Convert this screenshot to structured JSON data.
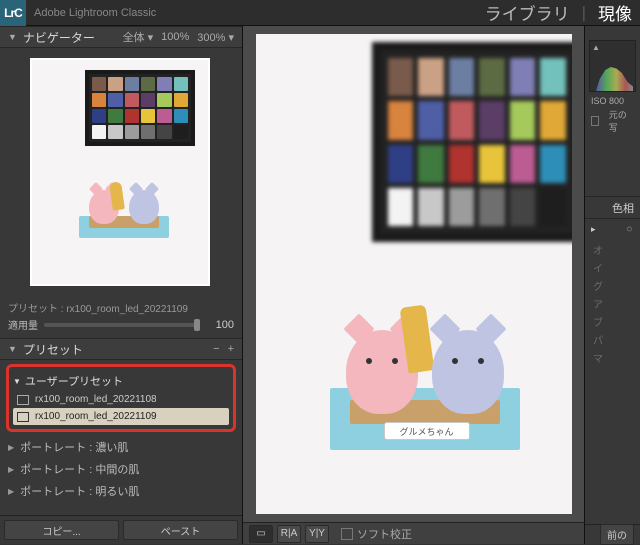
{
  "app": {
    "logo": "LrC",
    "name": "Adobe Lightroom Classic"
  },
  "modules": {
    "inactive": "ライブラリ",
    "sep": "|",
    "active": "現像"
  },
  "navigator": {
    "title": "ナビゲーター",
    "fit": "全体",
    "zoom1": "100%",
    "zoom2": "300%"
  },
  "preset_applied": {
    "label": "プリセット : rx100_room_led_20221109",
    "amount_label": "適用量",
    "amount_value": "100"
  },
  "presets_panel": {
    "title": "プリセット",
    "minus": "−",
    "plus": "+",
    "user_group": "ユーザープリセット",
    "items": [
      {
        "name": "rx100_room_led_20221108",
        "selected": false
      },
      {
        "name": "rx100_room_led_20221109",
        "selected": true
      }
    ],
    "builtins": [
      "ポートレート : 濃い肌",
      "ポートレート : 中間の肌",
      "ポートレート : 明るい肌"
    ],
    "copy": "コピー...",
    "paste": "ペースト"
  },
  "viewer": {
    "checker_colors": [
      "#7a5a4a",
      "#caa185",
      "#6c7fa3",
      "#5d6b44",
      "#7f7fb5",
      "#73c1bc",
      "#d8833e",
      "#4f5fa6",
      "#c15a5e",
      "#5a3e66",
      "#a6c95c",
      "#e0a836",
      "#2f3f86",
      "#3f7a3f",
      "#b0332f",
      "#e7c43a",
      "#bb5c93",
      "#2d8fb8",
      "#f3f3f3",
      "#c8c8c8",
      "#9c9c9c",
      "#6f6f6f",
      "#444444",
      "#1e1e1e"
    ],
    "tag_text": "グルメちゃん"
  },
  "center_foot": {
    "softproof": "ソフト校正",
    "btn_compare1": "R|A",
    "btn_compare2": "Y|Y"
  },
  "right": {
    "iso": "ISO 800",
    "orig_label": "元の写",
    "panel_color": "色相",
    "sliders": [
      "オ",
      "イ",
      "グ",
      "ア",
      "ブ",
      "パ",
      "マ"
    ],
    "prev_btn": "前の"
  }
}
